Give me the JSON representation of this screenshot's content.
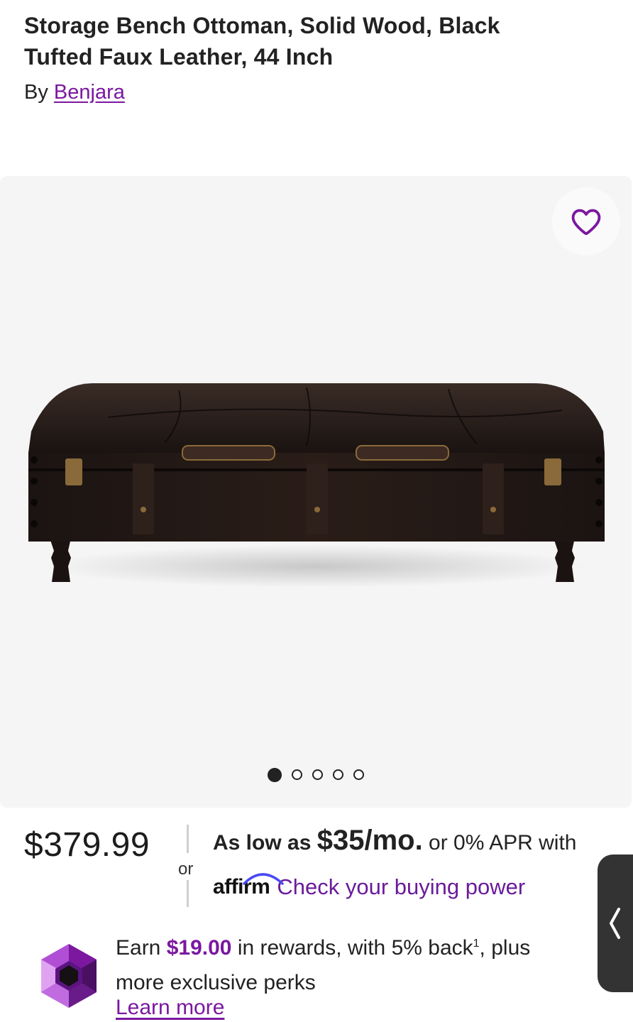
{
  "product": {
    "title": "Storage Bench Ottoman, Solid Wood, Black Tufted Faux Leather, 44 Inch",
    "by_prefix": "By",
    "brand": "Benjara"
  },
  "gallery": {
    "image_count": 5,
    "active_index": 0,
    "favorite_icon": "heart-outline-icon"
  },
  "pricing": {
    "price": "$379.99",
    "or_label": "or",
    "as_low_as": "As low as",
    "monthly": "$35/mo.",
    "apr_text": "or 0% APR with",
    "affirm_logo": "affirm",
    "affirm_link": "Check your buying power"
  },
  "rewards": {
    "earn": "Earn",
    "amount": "$19.00",
    "middle": "in rewards, with 5% back",
    "footnote": "1",
    "rest": ", plus more exclusive perks",
    "learn_more": "Learn more",
    "icon": "purple-gem-icon"
  },
  "side_tab": {
    "icon": "chevron-left-icon"
  },
  "colors": {
    "accent": "#7b189f",
    "gallery_bg": "#f5f5f5",
    "side_tab": "#333333"
  }
}
